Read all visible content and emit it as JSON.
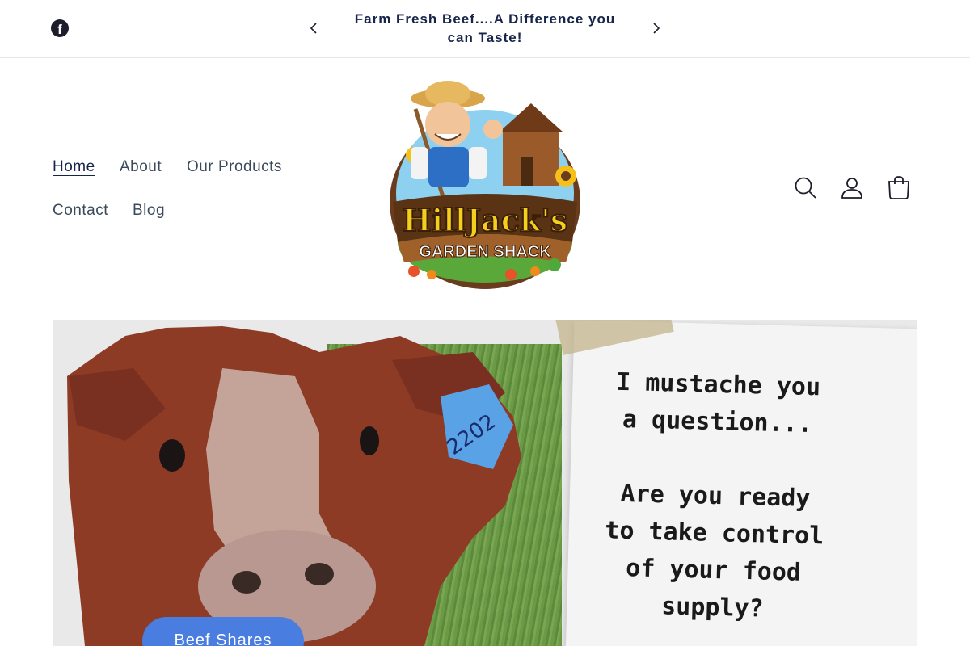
{
  "announcement": {
    "social_icon": "facebook-icon",
    "text": "Farm Fresh Beef....A Difference you can Taste!",
    "prev_icon": "chevron-left-icon",
    "next_icon": "chevron-right-icon"
  },
  "nav": {
    "items": [
      {
        "label": "Home",
        "active": true
      },
      {
        "label": "About"
      },
      {
        "label": "Our Products"
      },
      {
        "label": "Contact"
      },
      {
        "label": "Blog"
      }
    ]
  },
  "logo": {
    "line1": "HillJack's",
    "line2": "GARDEN SHACK"
  },
  "header_icons": [
    "search-icon",
    "account-icon",
    "cart-icon"
  ],
  "hero": {
    "note_text": "I mustache you\na question...\n\nAre you ready\nto take control\nof your food\nsupply?",
    "ear_tag": "2202",
    "cta_label": "Beef Shares"
  },
  "colors": {
    "accent": "#4a7de0",
    "nav_text": "#3a4a5c",
    "heading": "#16244a"
  }
}
